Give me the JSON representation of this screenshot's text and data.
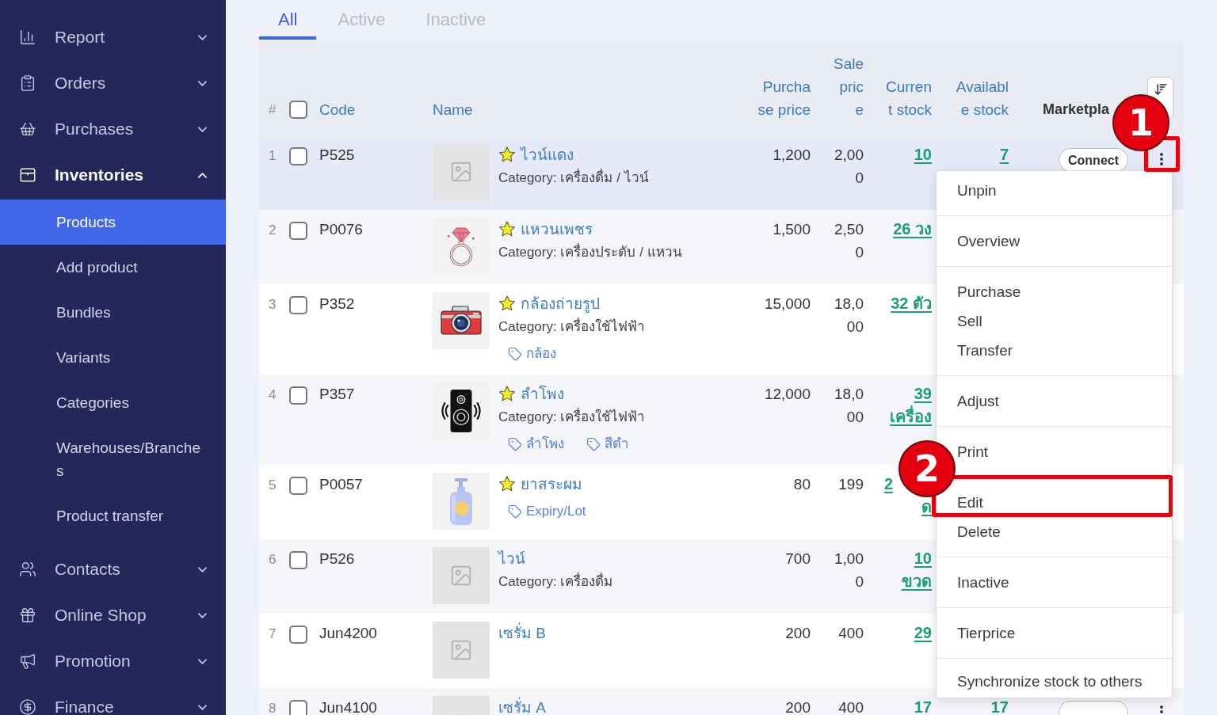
{
  "sidebar": {
    "items": [
      {
        "label": "Report",
        "expanded": false
      },
      {
        "label": "Orders",
        "expanded": false
      },
      {
        "label": "Purchases",
        "expanded": false
      },
      {
        "label": "Inventories",
        "expanded": true,
        "children": [
          {
            "label": "Products",
            "selected": true
          },
          {
            "label": "Add product",
            "selected": false
          },
          {
            "label": "Bundles",
            "selected": false
          },
          {
            "label": "Variants",
            "selected": false
          },
          {
            "label": "Categories",
            "selected": false
          },
          {
            "label": "Warehouses/Branches",
            "selected": false
          },
          {
            "label": "Product transfer",
            "selected": false
          }
        ]
      },
      {
        "label": "Contacts",
        "expanded": false
      },
      {
        "label": "Online Shop",
        "expanded": false
      },
      {
        "label": "Promotion",
        "expanded": false
      },
      {
        "label": "Finance",
        "expanded": false
      }
    ]
  },
  "tabs": [
    {
      "label": "All",
      "selected": true
    },
    {
      "label": "Active",
      "selected": false
    },
    {
      "label": "Inactive",
      "selected": false
    }
  ],
  "table": {
    "number_header": "#",
    "select_all": {
      "checked": false
    },
    "columns": [
      {
        "label": "Code",
        "sortable": true
      },
      {
        "label": "Name",
        "sortable": true
      },
      {
        "label": "Purchase price",
        "sortable": true
      },
      {
        "label": "Sale price",
        "sortable": true
      },
      {
        "label": "Current stock",
        "sortable": true
      },
      {
        "label": "Available stock",
        "sortable": true
      },
      {
        "label": "Marketpla",
        "sortable": false
      }
    ],
    "rows": [
      {
        "number": "1",
        "checked": false,
        "highlighted": true,
        "code": "P525",
        "thumbnail": {
          "kind": "placeholder"
        },
        "pinned": true,
        "name": "ไวน์แดง",
        "category": "Category: เครื่องดื่ม / ไวน์",
        "purchase_price": "1,200",
        "sale_price": "2,000",
        "current_stock": "10",
        "available_stock": "7",
        "marketplace": {
          "button": "Connect"
        }
      },
      {
        "number": "2",
        "checked": false,
        "highlighted": false,
        "code": "P0076",
        "thumbnail": {
          "kind": "ring"
        },
        "pinned": true,
        "name": "แหวนเพชร",
        "category": "Category: เครื่องประดับ / แหวน",
        "purchase_price": "1,500",
        "sale_price": "2,500",
        "current_stock": "26 วง"
      },
      {
        "number": "3",
        "checked": false,
        "highlighted": false,
        "code": "P352",
        "thumbnail": {
          "kind": "camera"
        },
        "pinned": true,
        "name": "กล้องถ่ายรูป",
        "category": "Category: เครื่องใช้ไฟฟ้า",
        "tags": [
          "กล้อง"
        ],
        "purchase_price": "15,000",
        "sale_price": "18,000",
        "current_stock": "32 ตัว"
      },
      {
        "number": "4",
        "checked": false,
        "highlighted": false,
        "code": "P357",
        "thumbnail": {
          "kind": "speaker"
        },
        "pinned": true,
        "name": "ลำโพง",
        "category": "Category: เครื่องใช้ไฟฟ้า",
        "tags": [
          "ลำโพง",
          "สีดำ"
        ],
        "purchase_price": "12,000",
        "sale_price": "18,000",
        "current_stock": "39 เครื่อง"
      },
      {
        "number": "5",
        "checked": false,
        "highlighted": false,
        "code": "P0057",
        "thumbnail": {
          "kind": "bottle"
        },
        "pinned": true,
        "name": "ยาสระผม",
        "tags": [
          "Expiry/Lot"
        ],
        "purchase_price": "80",
        "sale_price": "199",
        "current_stock": "2",
        "current_stock_wrap": "ด"
      },
      {
        "number": "6",
        "checked": false,
        "highlighted": false,
        "code": "P526",
        "thumbnail": {
          "kind": "placeholder"
        },
        "pinned": false,
        "name": "ไวน์",
        "category": "Category: เครื่องดื่ม",
        "purchase_price": "700",
        "sale_price": "1,000",
        "current_stock": "10 ขวด"
      },
      {
        "number": "7",
        "checked": false,
        "highlighted": false,
        "code": "Jun4200",
        "thumbnail": {
          "kind": "placeholder"
        },
        "pinned": false,
        "name": "เซรั่ม B",
        "purchase_price": "200",
        "sale_price": "400",
        "current_stock": "29"
      },
      {
        "number": "8",
        "checked": false,
        "highlighted": false,
        "code": "Jun4100",
        "thumbnail": {
          "kind": "placeholder"
        },
        "pinned": false,
        "name": "เซรั่ม A",
        "purchase_price": "200",
        "sale_price": "400",
        "current_stock": "17",
        "available_stock": "17",
        "marketplace": {
          "button_cut": true
        }
      }
    ]
  },
  "row_menu": {
    "groups": [
      {
        "items": [
          "Unpin"
        ]
      },
      {
        "items": [
          "Overview"
        ]
      },
      {
        "items": [
          "Purchase",
          "Sell",
          "Transfer"
        ]
      },
      {
        "items": [
          "Adjust"
        ]
      },
      {
        "items": [
          "Print"
        ]
      },
      {
        "items": [
          "Edit",
          "Delete"
        ]
      },
      {
        "items": [
          "Inactive"
        ]
      },
      {
        "items": [
          "Tierprice"
        ]
      },
      {
        "items": [
          "Synchronize stock to others"
        ]
      }
    ]
  },
  "annotations": [
    {
      "label": "1"
    },
    {
      "label": "2"
    }
  ]
}
